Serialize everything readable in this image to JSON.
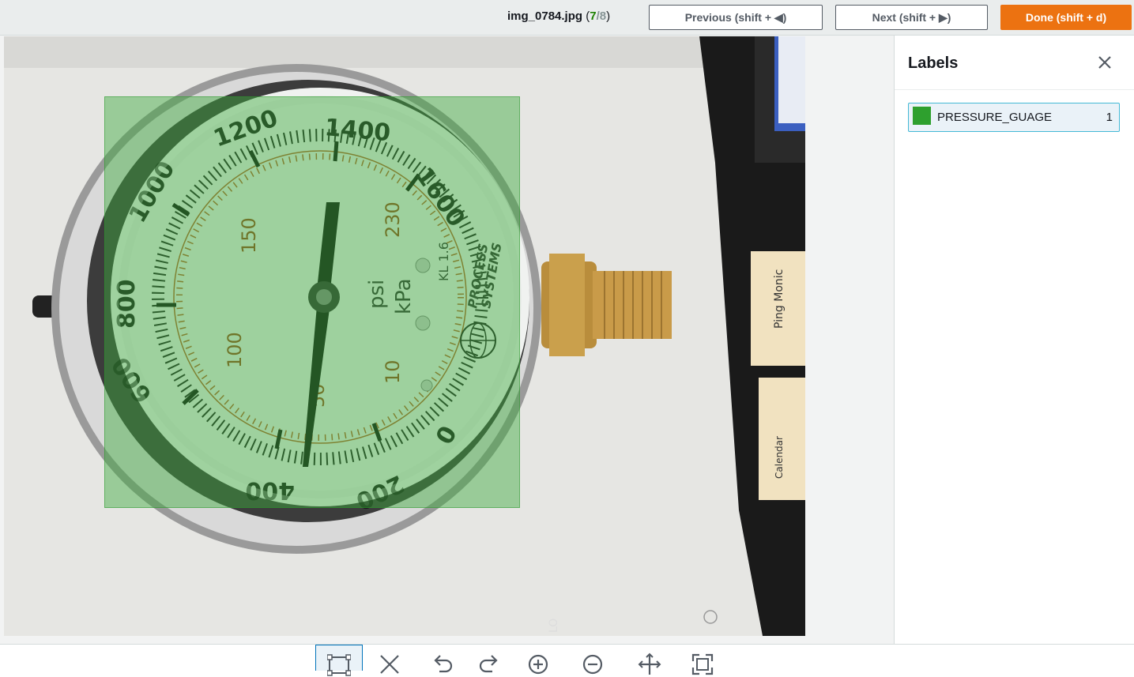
{
  "header": {
    "filename": "img_0784.jpg",
    "open_paren": "(",
    "current_index": "7",
    "separator": "/",
    "total": "8",
    "close_paren": ")",
    "previous_label": "Previous (shift + ◀)",
    "next_label": "Next (shift + ▶)",
    "done_label": "Done (shift + d)"
  },
  "panel": {
    "title": "Labels",
    "labels": [
      {
        "name": "PRESSURE_GUAGE",
        "count": "1",
        "color": "#2ea02e"
      }
    ]
  },
  "image": {
    "gauge": {
      "kpa_ticks": [
        "1200",
        "1400",
        "1600",
        "1000",
        "800",
        "600",
        "400",
        "200",
        "0"
      ],
      "psi_ticks": [
        "150",
        "230",
        "100",
        "50",
        "10"
      ],
      "unit_psi": "psi",
      "unit_kpa": "kPa",
      "class": "KL 1.6",
      "brand_line1": "PROCESS",
      "brand_line2": "SYSTEMS"
    }
  },
  "toolbar": {
    "tools": [
      "box-tool-icon",
      "delete-icon",
      "undo-icon",
      "redo-icon",
      "zoom-in-icon",
      "zoom-out-icon",
      "move-icon",
      "fit-icon"
    ]
  },
  "colors": {
    "accent": "#ec7211",
    "bbox": "#2ea02e",
    "selected_border": "#44b9d6"
  }
}
